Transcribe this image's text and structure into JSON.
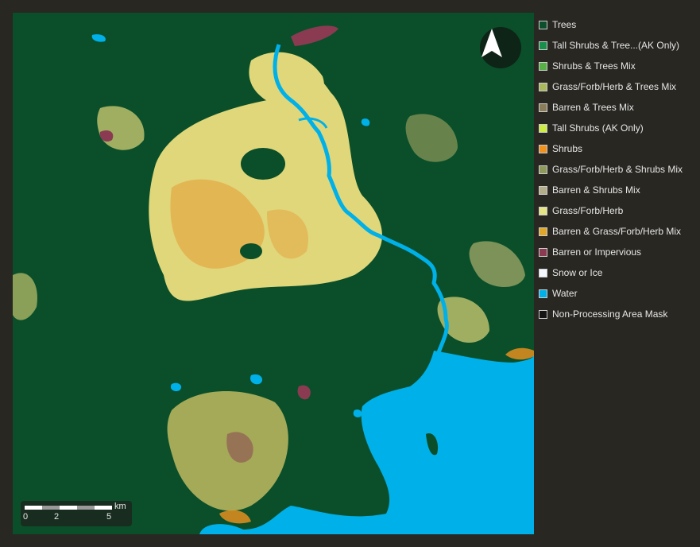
{
  "legend": [
    {
      "label": "Trees",
      "color": "#0b4f2b"
    },
    {
      "label": "Tall Shrubs & Tree...(AK Only)",
      "color": "#18904b"
    },
    {
      "label": "Shrubs & Trees Mix",
      "color": "#56b045"
    },
    {
      "label": "Grass/Forb/Herb & Trees Mix",
      "color": "#a9b85c"
    },
    {
      "label": "Barren & Trees Mix",
      "color": "#8a7e5a"
    },
    {
      "label": "Tall Shrubs (AK Only)",
      "color": "#ccee44"
    },
    {
      "label": "Shrubs",
      "color": "#f0921e"
    },
    {
      "label": "Grass/Forb/Herb & Shrubs Mix",
      "color": "#8e9a5a"
    },
    {
      "label": "Barren & Shrubs Mix",
      "color": "#b3ad8a"
    },
    {
      "label": "Grass/Forb/Herb",
      "color": "#e5e585"
    },
    {
      "label": "Barren & Grass/Forb/Herb Mix",
      "color": "#e0a82a"
    },
    {
      "label": "Barren or Impervious",
      "color": "#8a3b52"
    },
    {
      "label": "Snow or Ice",
      "color": "#f4f9ff"
    },
    {
      "label": "Water",
      "color": "#00b0e8"
    },
    {
      "label": "Non-Processing Area Mask",
      "color": "#151515"
    }
  ],
  "scale": {
    "unit": "km",
    "labels": [
      "0",
      "2",
      "5"
    ]
  },
  "north_arrow": "north-arrow-icon"
}
